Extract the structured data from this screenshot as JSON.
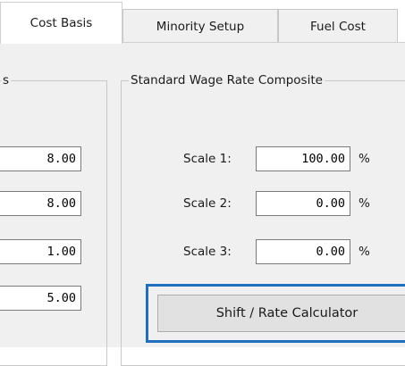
{
  "tabs": [
    {
      "label": "Cost Basis",
      "active": true
    },
    {
      "label": "Minority Setup",
      "active": false
    },
    {
      "label": "Fuel Cost",
      "active": false
    }
  ],
  "left_group": {
    "title_fragment": "s",
    "values": [
      "8.00",
      "8.00",
      "1.00",
      "5.00"
    ]
  },
  "wage_group": {
    "title": "Standard Wage Rate Composite",
    "scales": [
      {
        "label": "Scale 1:",
        "value": "100.00",
        "unit": "%"
      },
      {
        "label": "Scale 2:",
        "value": "0.00",
        "unit": "%"
      },
      {
        "label": "Scale 3:",
        "value": "0.00",
        "unit": "%"
      }
    ],
    "calculator_button": "Shift / Rate Calculator"
  },
  "colors": {
    "highlight": "#1f6fbf",
    "panel": "#f0f0f0"
  }
}
